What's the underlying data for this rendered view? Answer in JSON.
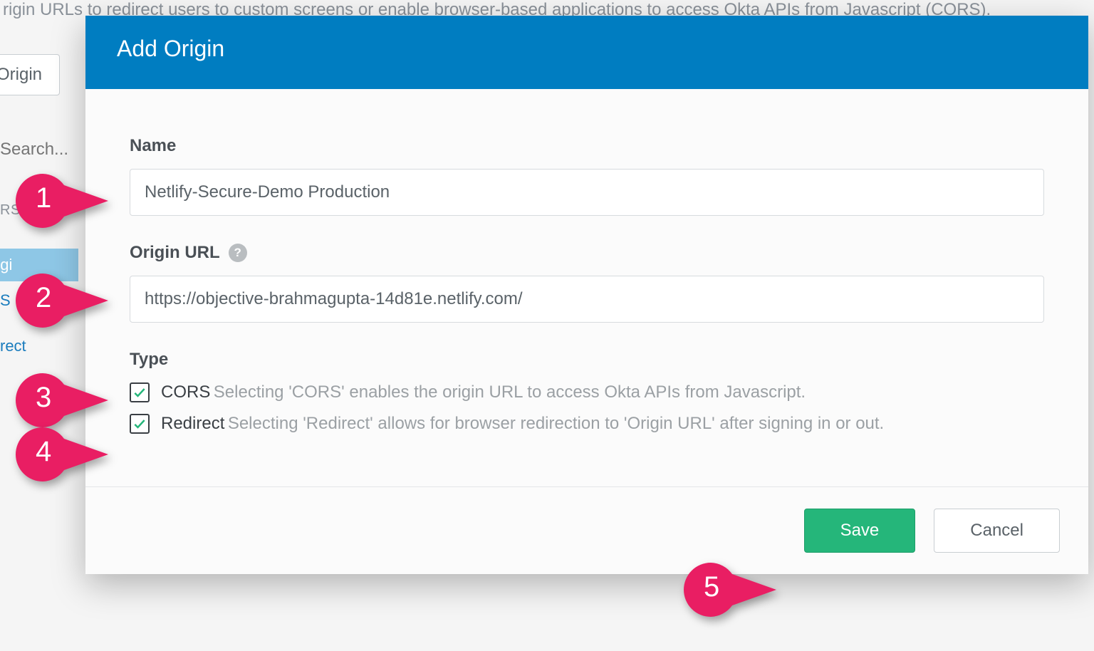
{
  "background": {
    "description_text": "rigin URLs to redirect users to custom screens or enable browser-based applications to access Okta APIs from Javascript (CORS).",
    "button_label": "Origin",
    "search_placeholder": "Search...",
    "filters_label": "RS",
    "sidebar_active": "rigi",
    "sidebar_item_s": "S",
    "sidebar_item_redirect": "rect"
  },
  "modal": {
    "title": "Add Origin",
    "name_label": "Name",
    "name_value": "Netlify-Secure-Demo Production",
    "origin_url_label": "Origin URL",
    "origin_url_value": "https://objective-brahmagupta-14d81e.netlify.com/",
    "type_label": "Type",
    "cors": {
      "checked": true,
      "label": "CORS",
      "description": "Selecting 'CORS' enables the origin URL to access Okta APIs from Javascript."
    },
    "redirect": {
      "checked": true,
      "label": "Redirect",
      "description": "Selecting 'Redirect' allows for browser redirection to 'Origin URL' after signing in or out."
    },
    "save_label": "Save",
    "cancel_label": "Cancel"
  },
  "callouts": [
    "1",
    "2",
    "3",
    "4",
    "5"
  ],
  "colors": {
    "header": "#007dc1",
    "primary": "#25b67a",
    "callout": "#e91e63"
  }
}
